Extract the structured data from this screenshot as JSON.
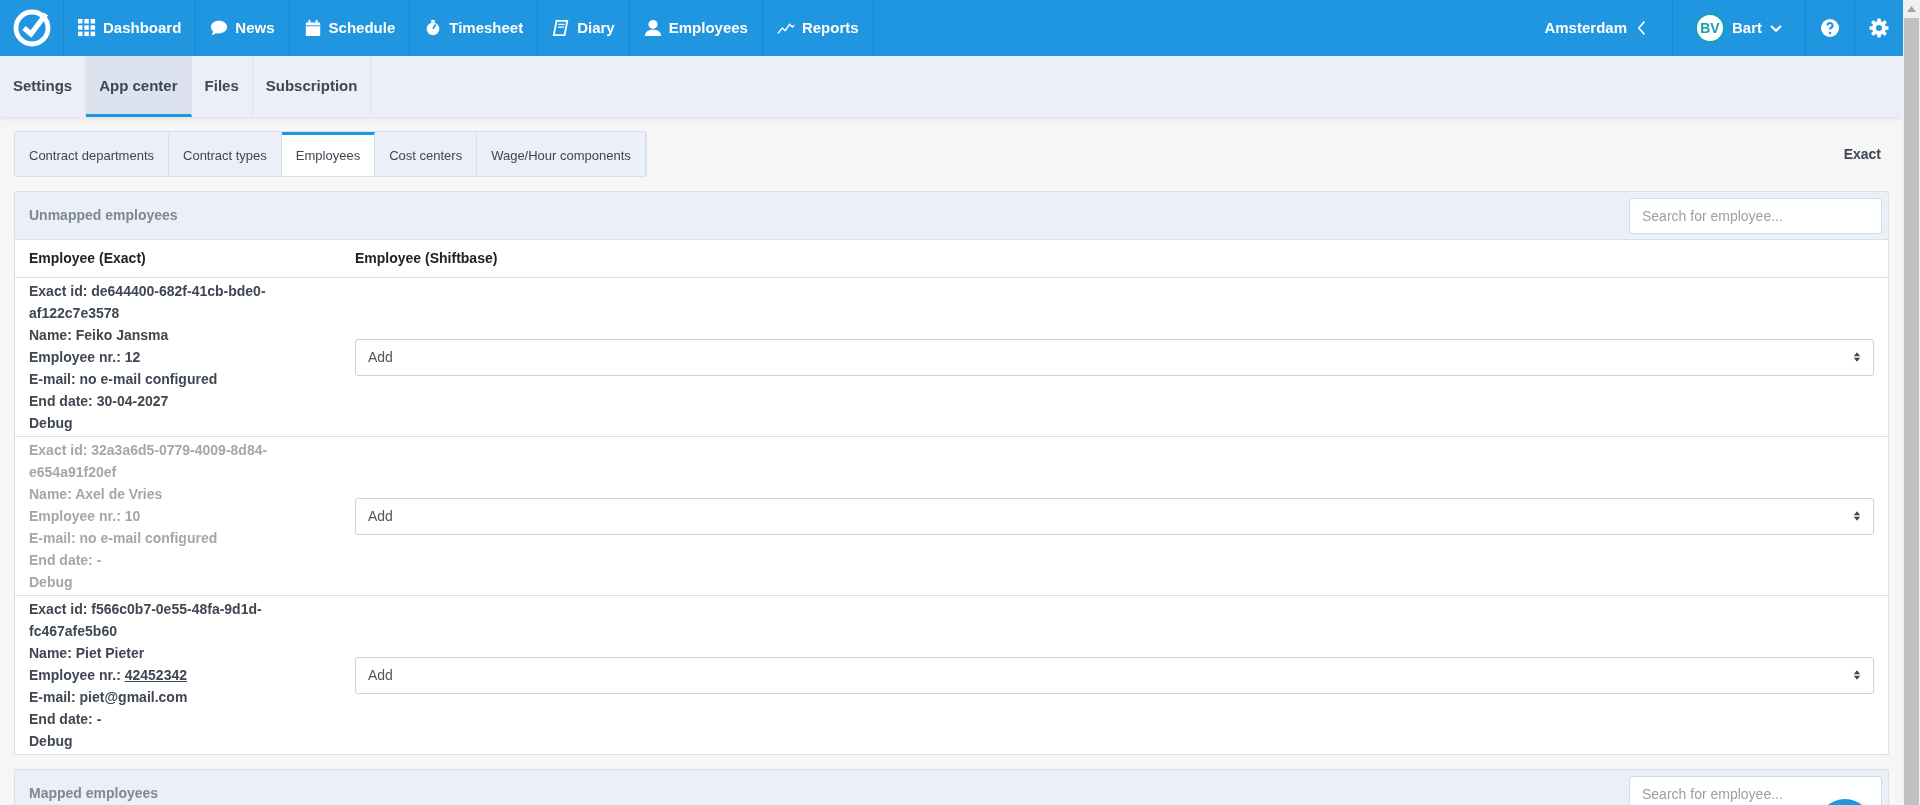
{
  "nav": {
    "items": [
      {
        "label": "Dashboard"
      },
      {
        "label": "News"
      },
      {
        "label": "Schedule"
      },
      {
        "label": "Timesheet"
      },
      {
        "label": "Diary"
      },
      {
        "label": "Employees"
      },
      {
        "label": "Reports"
      }
    ],
    "location": "Amsterdam",
    "user": {
      "initials": "BV",
      "name": "Bart"
    }
  },
  "subnav": [
    {
      "label": "Settings",
      "selected": false
    },
    {
      "label": "App center",
      "selected": true
    },
    {
      "label": "Files",
      "selected": false
    },
    {
      "label": "Subscription",
      "selected": false
    }
  ],
  "subtabs": [
    {
      "label": "Contract departments",
      "selected": false
    },
    {
      "label": "Contract types",
      "selected": false
    },
    {
      "label": "Employees",
      "selected": true
    },
    {
      "label": "Cost centers",
      "selected": false
    },
    {
      "label": "Wage/Hour components",
      "selected": false
    }
  ],
  "integration": "Exact",
  "unmapped": {
    "title": "Unmapped employees",
    "search": {
      "placeholder": "Search for employee..."
    },
    "columns": [
      "Employee (Exact)",
      "Employee (Shiftbase)"
    ],
    "rows": [
      {
        "inactive": false,
        "select": "Add",
        "lines": [
          {
            "text": "Exact id: de644400-682f-41cb-bde0-af122c7e3578"
          },
          {
            "text": "Name: Feiko Jansma"
          },
          {
            "text": "Employee nr.: 12"
          },
          {
            "text": "E-mail: no e-mail configured"
          },
          {
            "text": "End date: 30-04-2027"
          },
          {
            "text": "Debug"
          }
        ]
      },
      {
        "inactive": true,
        "select": "Add",
        "lines": [
          {
            "text": "Exact id: 32a3a6d5-0779-4009-8d84-e654a91f20ef"
          },
          {
            "text": "Name: Axel de Vries"
          },
          {
            "text": "Employee nr.: 10"
          },
          {
            "text": "E-mail: no e-mail configured"
          },
          {
            "text": "End date: -"
          },
          {
            "text": "Debug"
          }
        ]
      },
      {
        "inactive": false,
        "select": "Add",
        "lines": [
          {
            "text": "Exact id: f566c0b7-0e55-48fa-9d1d-fc467afe5b60"
          },
          {
            "text": "Name: Piet Pieter"
          },
          {
            "text": "Employee nr.:",
            "link": "42452342"
          },
          {
            "text": "E-mail: piet@gmail.com"
          },
          {
            "text": "End date: -"
          },
          {
            "text": "Debug"
          }
        ]
      }
    ]
  },
  "mapped": {
    "title": "Mapped employees",
    "search": {
      "placeholder": "Search for employee..."
    }
  }
}
